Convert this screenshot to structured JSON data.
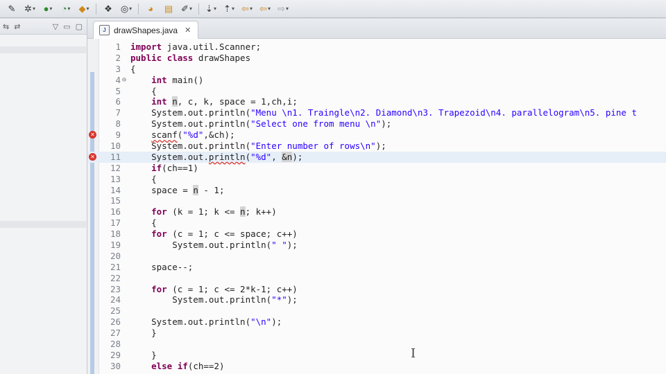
{
  "toolbar": {
    "icons": [
      "pin-icon",
      "gear-icon",
      "run-icon",
      "new-class-icon",
      "new-package-icon",
      "open-type-icon",
      "search-icon",
      "open-task-icon",
      "brush-icon",
      "wand-icon",
      "annotation-icon",
      "next-annotation-icon",
      "back-icon",
      "forward-icon"
    ]
  },
  "left_panel": {
    "icons": [
      "collapse-icon",
      "link-icon",
      "view-menu-icon",
      "minimize-icon",
      "maximize-icon"
    ]
  },
  "editor": {
    "tab_label": "drawShapes.java",
    "tab_close": "✕",
    "lines": [
      {
        "num": "1",
        "text": "import java.util.Scanner;"
      },
      {
        "num": "2",
        "text": "public class drawShapes"
      },
      {
        "num": "3",
        "text": "{"
      },
      {
        "num": "4",
        "text": "    int main()"
      },
      {
        "num": "5",
        "text": "    {"
      },
      {
        "num": "6",
        "text": "    int n, c, k, space = 1,ch,i;"
      },
      {
        "num": "7",
        "text": "    System.out.println(\"Menu \\n1. Traingle\\n2. Diamond\\n3. Trapezoid\\n4. parallelogram\\n5. pine t"
      },
      {
        "num": "8",
        "text": "    System.out.println(\"Select one from menu \\n\");"
      },
      {
        "num": "9",
        "text": "    scanf(\"%d\",&ch);"
      },
      {
        "num": "10",
        "text": "    System.out.println(\"Enter number of rows\\n\");"
      },
      {
        "num": "11",
        "text": "    System.out.println(\"%d\", &n);"
      },
      {
        "num": "12",
        "text": "    if(ch==1)"
      },
      {
        "num": "13",
        "text": "    {"
      },
      {
        "num": "14",
        "text": "    space = n - 1;"
      },
      {
        "num": "15",
        "text": ""
      },
      {
        "num": "16",
        "text": "    for (k = 1; k <= n; k++)"
      },
      {
        "num": "17",
        "text": "    {"
      },
      {
        "num": "18",
        "text": "    for (c = 1; c <= space; c++)"
      },
      {
        "num": "19",
        "text": "        System.out.println(\" \");"
      },
      {
        "num": "20",
        "text": ""
      },
      {
        "num": "21",
        "text": "    space--;"
      },
      {
        "num": "22",
        "text": ""
      },
      {
        "num": "23",
        "text": "    for (c = 1; c <= 2*k-1; c++)"
      },
      {
        "num": "24",
        "text": "        System.out.println(\"*\");"
      },
      {
        "num": "25",
        "text": ""
      },
      {
        "num": "26",
        "text": "    System.out.println(\"\\n\");"
      },
      {
        "num": "27",
        "text": "    }"
      },
      {
        "num": "28",
        "text": ""
      },
      {
        "num": "29",
        "text": "    }"
      },
      {
        "num": "30",
        "text": "    else if(ch==2)"
      }
    ],
    "error_lines": [
      "9",
      "11"
    ],
    "current_line": "11"
  },
  "colors": {
    "keyword": "#7f0055",
    "string": "#2a00ff",
    "error": "#d9342b",
    "current_line": "#e6eef8"
  }
}
